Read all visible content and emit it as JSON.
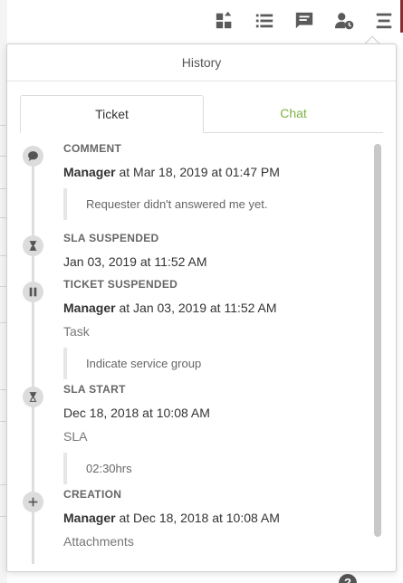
{
  "toolbar": {
    "icons": [
      "dashboard-add-icon",
      "list-icon",
      "chat-icon",
      "user-clock-icon",
      "menu-icon"
    ]
  },
  "panel": {
    "title": "History",
    "tabs": [
      {
        "label": "Ticket",
        "active": true
      },
      {
        "label": "Chat",
        "active": false
      }
    ]
  },
  "events": [
    {
      "type": "COMMENT",
      "icon": "comment-icon",
      "actor": "Manager",
      "when": " at Mar 18, 2019 at 01:47 PM",
      "quote": "Requester didn't answered me yet."
    },
    {
      "type": "SLA SUSPENDED",
      "icon": "hourglass-icon",
      "when": "Jan 03, 2019 at 11:52 AM"
    },
    {
      "type": "TICKET SUSPENDED",
      "icon": "pause-icon",
      "actor": "Manager",
      "when": " at Jan 03, 2019 at 11:52 AM",
      "field": "Task",
      "quote": "Indicate service group"
    },
    {
      "type": "SLA START",
      "icon": "hourglass-icon",
      "when": "Dec 18, 2018 at 10:08 AM",
      "field": "SLA",
      "quote": "02:30hrs"
    },
    {
      "type": "CREATION",
      "icon": "plus-icon",
      "actor": "Manager",
      "when": " at Dec 18, 2018 at 10:08 AM",
      "field": "Attachments"
    }
  ],
  "colors": {
    "accent": "#7cb342",
    "icon_bg": "#dcdcdc"
  }
}
